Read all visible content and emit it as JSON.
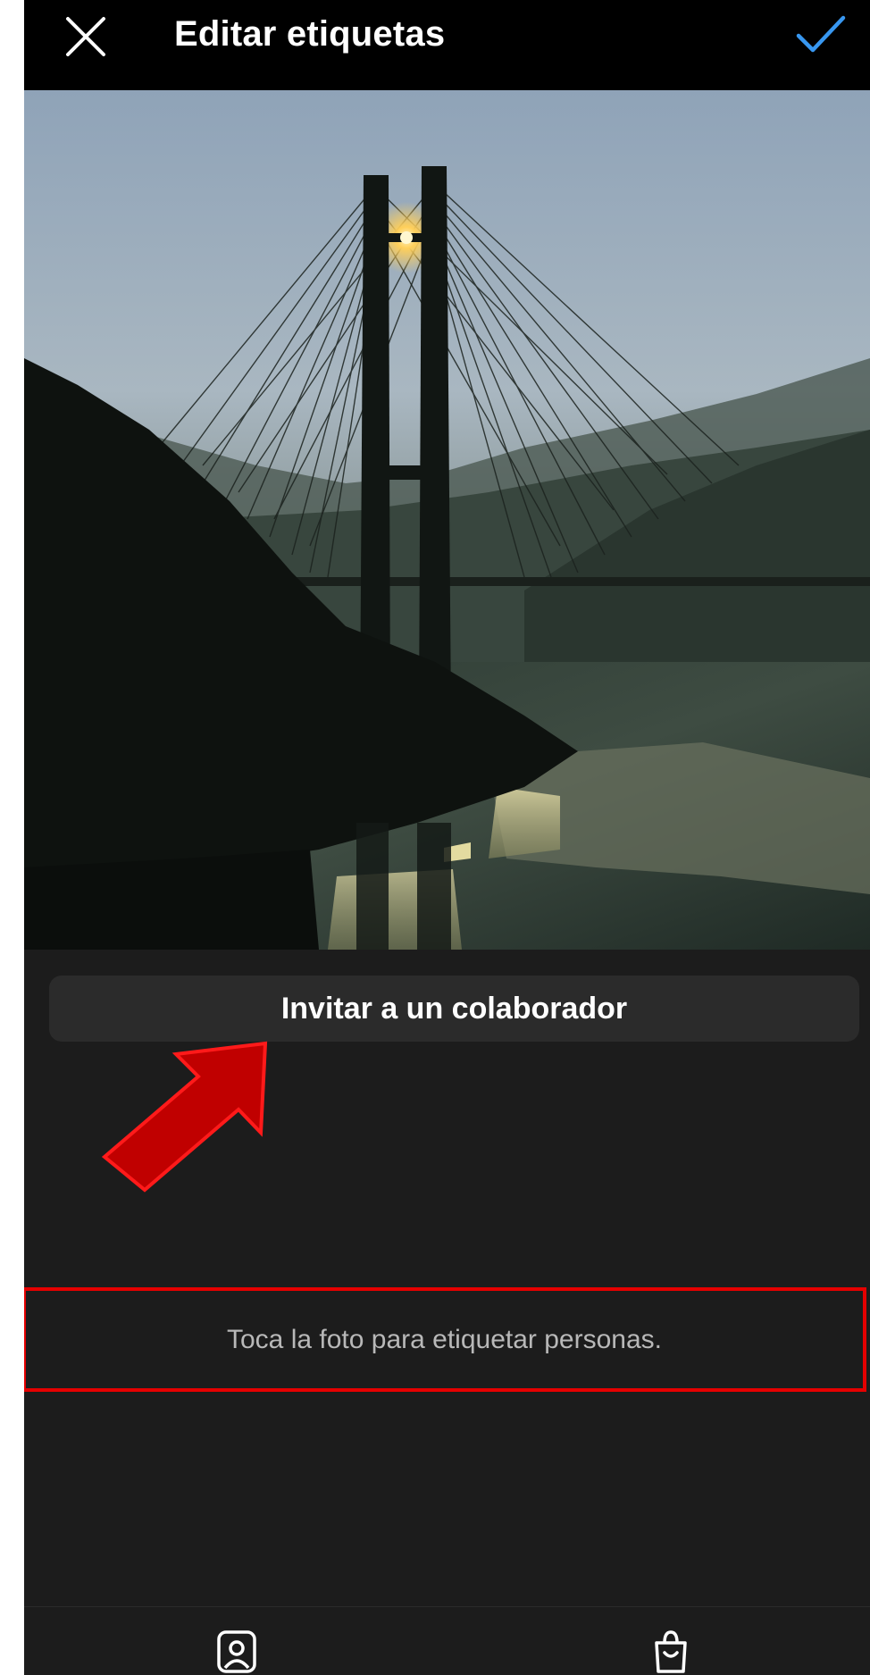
{
  "header": {
    "title": "Editar etiquetas",
    "close_icon": "close-icon",
    "confirm_icon": "checkmark-icon"
  },
  "photo": {
    "subject": "cable-stayed-bridge-at-sunset"
  },
  "collaborator_button": {
    "label": "Invitar a un colaborador"
  },
  "hint": {
    "text": "Toca la foto para etiquetar personas."
  },
  "tabs": [
    {
      "icon": "tag-people-icon"
    },
    {
      "icon": "shopping-bag-icon"
    }
  ],
  "colors": {
    "background": "#1c1c1c",
    "topbar": "#000000",
    "accent": "#3897f0",
    "button_bg": "#2b2b2b",
    "annotation": "#e50000",
    "arrow_fill": "#c00000"
  }
}
